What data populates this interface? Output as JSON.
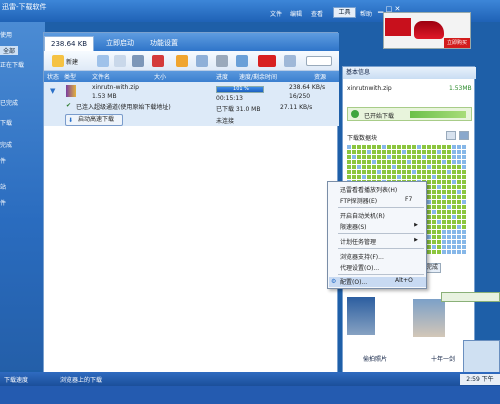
{
  "title_bar": {
    "app_title": "迅雷-下载软件",
    "menus": [
      "文件",
      "编辑",
      "查看",
      "工具",
      "帮助"
    ],
    "tools_menu": "工具",
    "ad_button": "立即购买"
  },
  "left_strip": {
    "items": [
      "使用",
      "全部",
      "正在下载",
      "已完成",
      "下载",
      "完成",
      "件",
      "站",
      "件"
    ]
  },
  "main": {
    "tabs": [
      "238.64 KB",
      "立即启动",
      "功能设置"
    ],
    "toolbar": {
      "new_label": "新建"
    },
    "columns": [
      "状态",
      "类型",
      "文件名",
      "大小",
      "进度",
      "速度/剩余时间",
      "资源"
    ],
    "rows": [
      {
        "filename": "xinrutn-with.zip",
        "size_total": "1.53 MB",
        "status_text": "已连入超级通道(使用原始下载地址)",
        "progress_label": "101 %",
        "progress_pct": 101,
        "time_left": "00:15:13",
        "downloaded": "已下载 31.0 MB",
        "speed": "238.64 KB/s",
        "speed_sub": "16/250",
        "speed2": "27.11 KB/s",
        "connections": "未连接",
        "download_button": "启动高速下载"
      }
    ]
  },
  "right_panel": {
    "title": "基本信息",
    "url": "xinrutnwith.zip",
    "size": "1.53MB",
    "status": "已开始下载",
    "section": "下载数据块",
    "status_tag": "完成",
    "images": [
      {
        "label": "偷拍照片"
      },
      {
        "label": "十年一剑"
      }
    ]
  },
  "context_menu": {
    "items": [
      {
        "label": "迅雷看看播放列表(H)",
        "shortcut": "",
        "submenu": false
      },
      {
        "label": "FTP探测器(E)",
        "shortcut": "F7",
        "submenu": false
      },
      {
        "label": "开启自动关机(R)",
        "shortcut": "",
        "submenu": false
      },
      {
        "label": "限速器(S)",
        "shortcut": "",
        "submenu": true
      },
      {
        "label": "计划任务管理",
        "shortcut": "",
        "submenu": true
      },
      {
        "label": "浏览器支持(F)...",
        "shortcut": "",
        "submenu": false
      },
      {
        "label": "代理设置(O)...",
        "shortcut": "",
        "submenu": false
      },
      {
        "label": "配置(O)...",
        "shortcut": "Alt+O",
        "submenu": false,
        "selected": true
      }
    ]
  },
  "taskbar": {
    "left_items": [
      "下载速度",
      "浏览器上的下载"
    ],
    "clock": "2:59 下午"
  },
  "colors": {
    "accent": "#2f75c9",
    "progress": "#2a78d6",
    "grid_green": "#8cc63e",
    "grid_blue": "#86b7e8"
  }
}
